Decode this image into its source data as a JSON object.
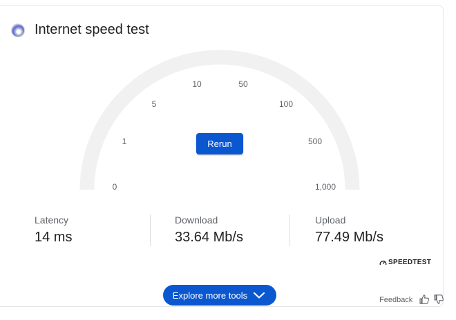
{
  "card": {
    "title": "Internet speed test",
    "logo_icon": "speedtest-orb-icon"
  },
  "gauge": {
    "ticks": [
      "0",
      "1",
      "5",
      "10",
      "50",
      "100",
      "500",
      "1,000"
    ],
    "track_color": "#f1f1f1"
  },
  "rerun_label": "Rerun",
  "stats": {
    "latency": {
      "label": "Latency",
      "value": "14 ms"
    },
    "download": {
      "label": "Download",
      "value": "33.64 Mb/s"
    },
    "upload": {
      "label": "Upload",
      "value": "77.49 Mb/s"
    }
  },
  "provider": "SPEEDTEST",
  "explore_label": "Explore more tools",
  "feedback_label": "Feedback",
  "colors": {
    "accent": "#0b57d0"
  }
}
